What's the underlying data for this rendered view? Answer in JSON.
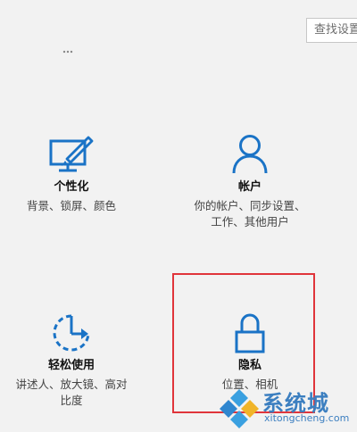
{
  "search": {
    "placeholder": "查找设置"
  },
  "tiles": [
    {
      "id": "personalization",
      "title": "个性化",
      "desc": "背景、锁屏、颜色",
      "icon": "personalization-icon"
    },
    {
      "id": "accounts",
      "title": "帐户",
      "desc": "你的帐户、同步设置、\n工作、其他用户",
      "icon": "account-icon"
    },
    {
      "id": "ease",
      "title": "轻松使用",
      "desc": "讲述人、放大镜、高对\n比度",
      "icon": "ease-of-access-icon"
    },
    {
      "id": "privacy",
      "title": "隐私",
      "desc": "位置、相机",
      "icon": "lock-icon"
    }
  ],
  "watermark": {
    "text": "系统城",
    "url": "xitongcheng.com"
  },
  "colors": {
    "accent": "#1a73c6",
    "highlight": "#e0353b",
    "background": "#f2f2f2"
  }
}
